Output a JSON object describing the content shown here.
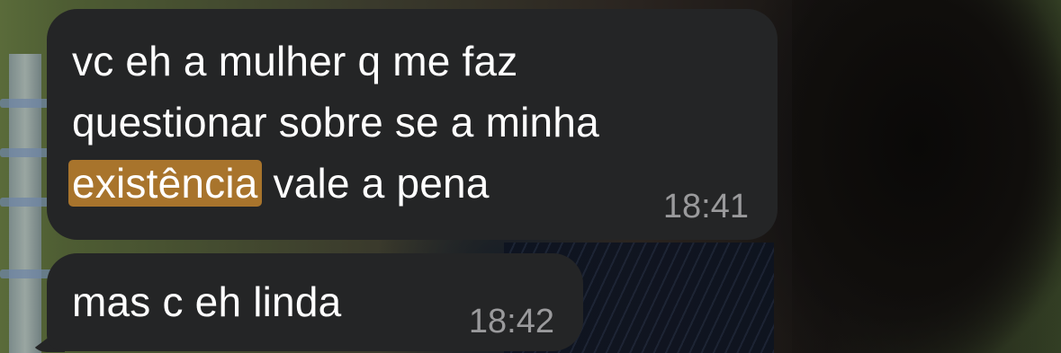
{
  "messages": [
    {
      "line1": "vc eh a mulher q me faz",
      "line2": "questionar sobre se a minha",
      "line3_highlight": "existência",
      "line3_rest": " vale a pena",
      "time": "18:41"
    },
    {
      "text": "mas c eh linda",
      "time": "18:42"
    }
  ],
  "colors": {
    "bubble": "#242526",
    "highlight": "#a8742c",
    "timestamp": "#9a9a9c"
  }
}
